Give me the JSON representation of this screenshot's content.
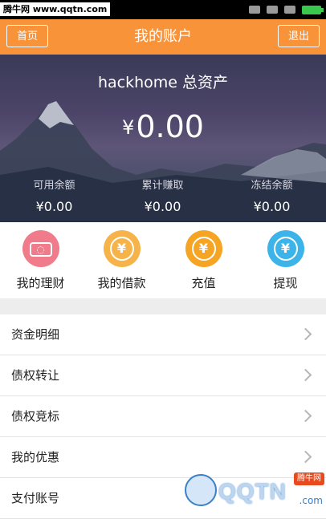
{
  "statusbar": {
    "watermark": "腾牛网 www.qqtn.com"
  },
  "navbar": {
    "home": "首页",
    "title": "我的账户",
    "exit": "退出"
  },
  "hero": {
    "title": "hackhome 总资产",
    "currency": "¥",
    "amount": "0.00",
    "stats": [
      {
        "label": "可用余额",
        "value": "¥0.00"
      },
      {
        "label": "累计赚取",
        "value": "¥0.00"
      },
      {
        "label": "冻结余额",
        "value": "¥0.00"
      }
    ]
  },
  "actions": [
    {
      "label": "我的理财",
      "icon": "wealth-icon",
      "color": "#f07b8a"
    },
    {
      "label": "我的借款",
      "icon": "loan-icon",
      "color": "#f6b34a"
    },
    {
      "label": "充值",
      "icon": "recharge-icon",
      "color": "#f5a423"
    },
    {
      "label": "提现",
      "icon": "withdraw-icon",
      "color": "#3cb4e9"
    }
  ],
  "menu": [
    {
      "label": "资金明细"
    },
    {
      "label": "债权转让"
    },
    {
      "label": "债权竞标"
    },
    {
      "label": "我的优惠"
    },
    {
      "label": "支付账号"
    }
  ],
  "watermark_bottom": {
    "brand": "QQTN",
    "badge": "腾牛网",
    "suffix": ".com"
  },
  "colors": {
    "accent": "#f9933a"
  }
}
